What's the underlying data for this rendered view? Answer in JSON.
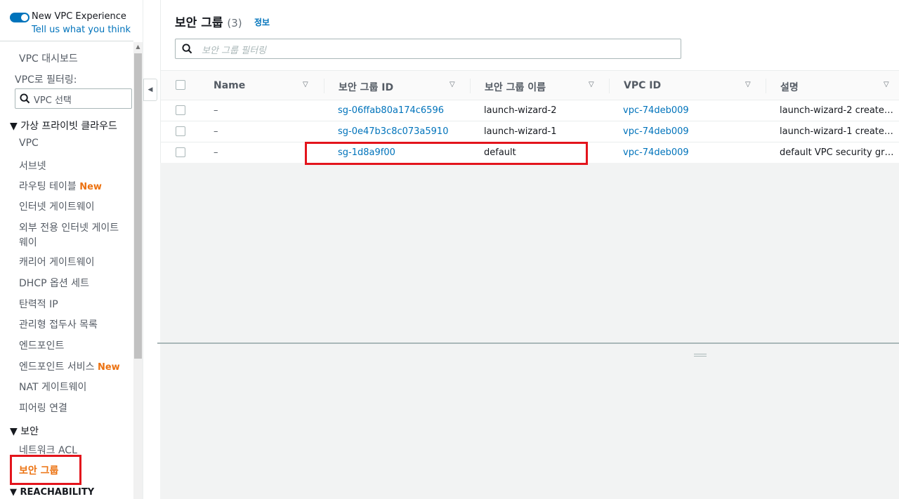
{
  "vpc_experience": {
    "title": "New VPC Experience",
    "link": "Tell us what you think"
  },
  "sidebar": {
    "dashboard": "VPC 대시보드",
    "filter_label": "VPC로 필터링:",
    "filter_placeholder": "VPC 선택",
    "section_vpc": "▼ 가상 프라이빗 클라우드",
    "items_vpc": [
      {
        "label": "VPC"
      },
      {
        "label": "서브넷"
      },
      {
        "label": "라우팅 테이블",
        "badge": "New"
      },
      {
        "label": "인터넷 게이트웨이"
      },
      {
        "label": "외부 전용 인터넷 게이트",
        "label2": "웨이"
      },
      {
        "label": "캐리어 게이트웨이"
      },
      {
        "label": "DHCP 옵션 세트"
      },
      {
        "label": "탄력적 IP"
      },
      {
        "label": "관리형 접두사 목록"
      },
      {
        "label": "엔드포인트"
      },
      {
        "label": "엔드포인트 서비스",
        "badge": "New"
      },
      {
        "label": "NAT 게이트웨이"
      },
      {
        "label": "피어링 연결"
      }
    ],
    "section_security": "▼ 보안",
    "items_security": [
      {
        "label": "네트워크 ACL"
      },
      {
        "label": "보안 그룹"
      }
    ],
    "section_reachability": "▼ REACHABILITY"
  },
  "panel": {
    "title": "보안 그룹",
    "count": "(3)",
    "info": "정보",
    "filter_placeholder": "보안 그룹 필터링"
  },
  "table": {
    "columns": [
      "Name",
      "보안 그룹 ID",
      "보안 그룹 이름",
      "VPC ID",
      "설명"
    ],
    "rows": [
      {
        "name": "–",
        "sg_id": "sg-06ffab80a174c6596",
        "sg_name": "launch-wizard-2",
        "vpc_id": "vpc-74deb009",
        "desc": "launch-wizard-2 create…"
      },
      {
        "name": "–",
        "sg_id": "sg-0e47b3c8c073a5910",
        "sg_name": "launch-wizard-1",
        "vpc_id": "vpc-74deb009",
        "desc": "launch-wizard-1 create…"
      },
      {
        "name": "–",
        "sg_id": "sg-1d8a9f00",
        "sg_name": "default",
        "vpc_id": "vpc-74deb009",
        "desc": "default VPC security gr…"
      }
    ]
  },
  "colors": {
    "link": "#0073bb",
    "active": "#ec7211",
    "highlight": "#e3141c"
  }
}
